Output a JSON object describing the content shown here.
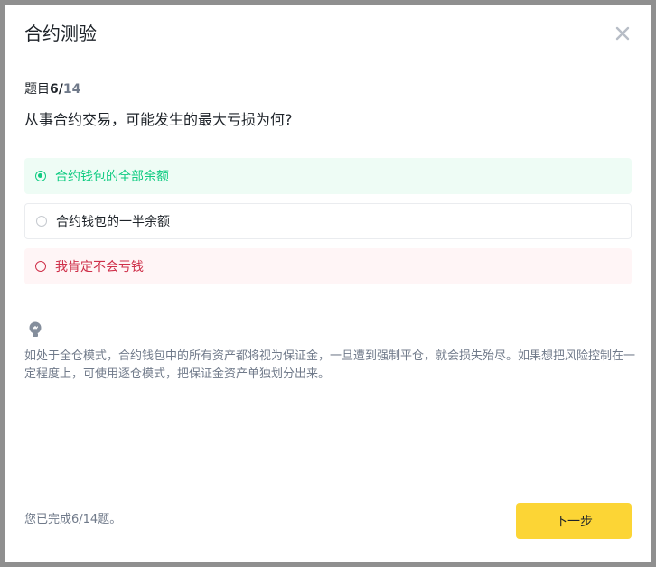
{
  "dialog": {
    "title": "合约测验",
    "close_icon": "close-icon"
  },
  "progress": {
    "label": "题目",
    "current": "6",
    "separator": "/",
    "total": "14"
  },
  "question": "从事合约交易，可能发生的最大亏损为何?",
  "options": [
    {
      "label": "合约钱包的全部余额",
      "state": "correct",
      "color": "#0ecb81"
    },
    {
      "label": "合约钱包的一半余额",
      "state": "neutral",
      "color": "#1e2329"
    },
    {
      "label": "我肯定不会亏钱",
      "state": "wrong",
      "color": "#cf304a"
    }
  ],
  "hint": {
    "icon": "lightbulb-icon",
    "text": "如处于全仓模式，合约钱包中的所有资产都将视为保证金，一旦遭到强制平仓，就会损失殆尽。如果想把风险控制在一定程度上，可使用逐仓模式，把保证金资产单独划分出来。"
  },
  "footer": {
    "status": "您已完成6/14题。",
    "next_label": "下一步",
    "accent": "#fcd535"
  }
}
